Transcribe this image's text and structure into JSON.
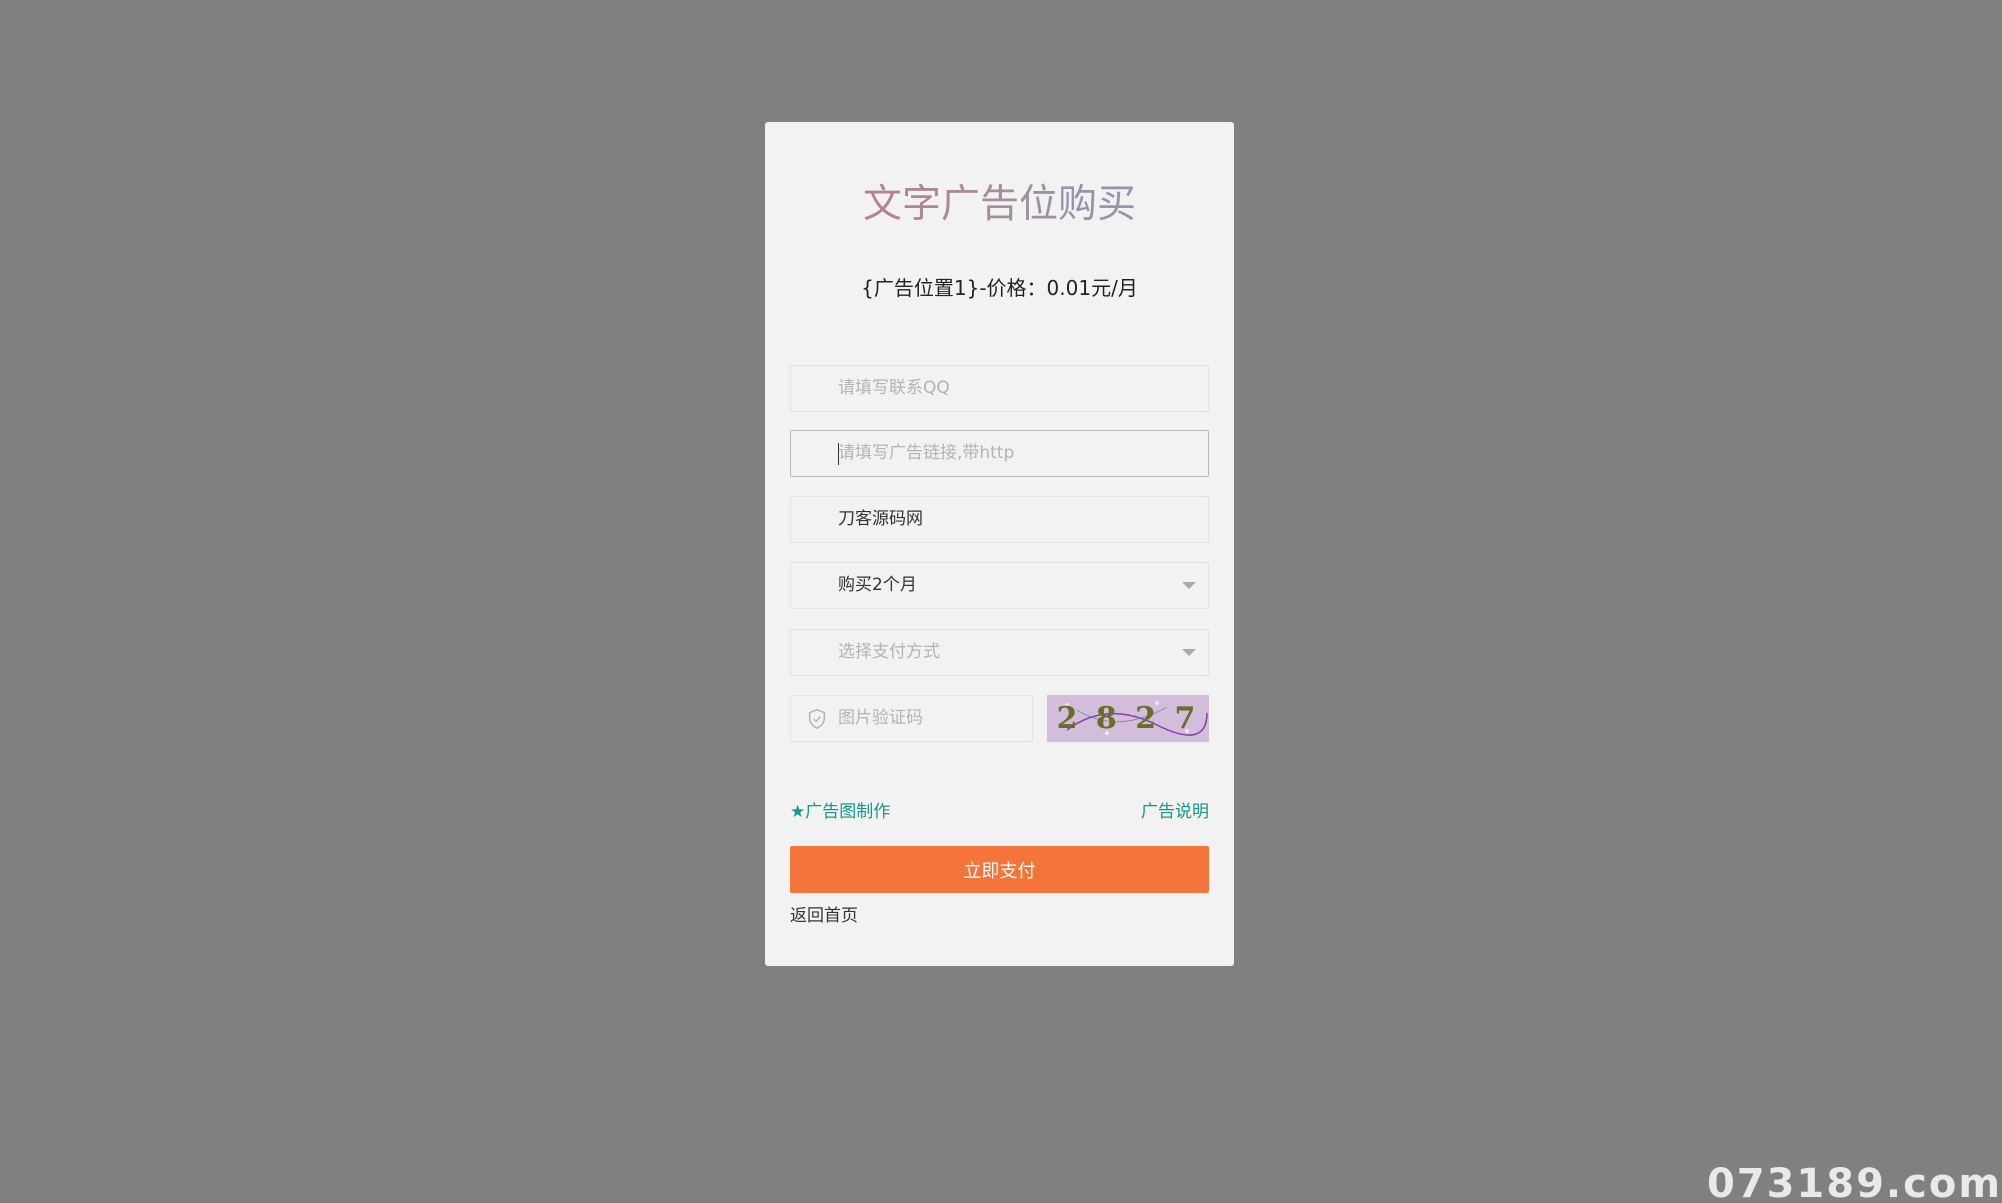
{
  "title": "文字广告位购买",
  "price_line": "{广告位置1}-价格：0.01元/月",
  "fields": {
    "qq": {
      "placeholder": "请填写联系QQ",
      "value": ""
    },
    "url": {
      "placeholder": "请填写广告链接,带http",
      "value": ""
    },
    "name": {
      "value": "刀客源码网"
    },
    "months": {
      "selected": "购买2个月"
    },
    "payment": {
      "placeholder": "选择支付方式"
    },
    "captcha": {
      "placeholder": "图片验证码",
      "image_text": "2 8 2 7"
    }
  },
  "links": {
    "ad_image_make": "★广告图制作",
    "ad_explain": "广告说明",
    "back_home": "返回首页"
  },
  "buttons": {
    "pay_now": "立即支付"
  },
  "watermark": "073189.com",
  "colors": {
    "background_overlay": "#808080",
    "card": "#f2f2f2",
    "accent_link": "#14998a",
    "pay_button": "#f4743b"
  }
}
